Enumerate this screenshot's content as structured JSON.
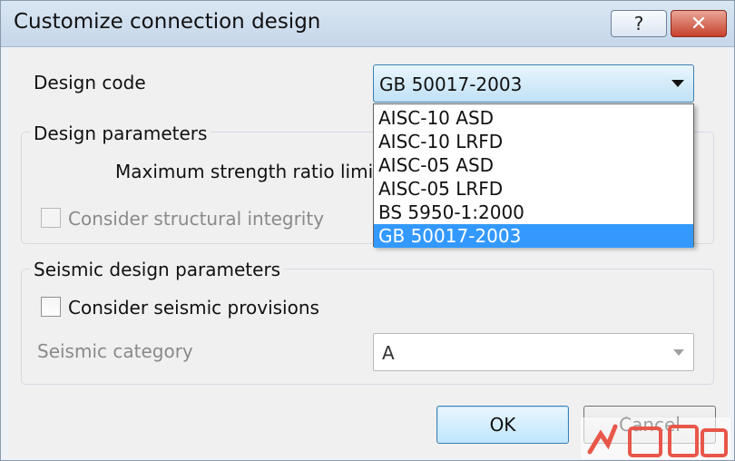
{
  "window": {
    "title": "Customize connection design",
    "help_label": "?",
    "close_label": "✕"
  },
  "design_code": {
    "label": "Design code",
    "selected": "GB 50017-2003",
    "options": [
      "AISC-10 ASD",
      "AISC-10 LRFD",
      "AISC-05 ASD",
      "AISC-05 LRFD",
      "BS 5950-1:2000",
      "GB 50017-2003"
    ],
    "selected_index": 5
  },
  "design_parameters": {
    "title": "Design parameters",
    "max_strength_label": "Maximum strength ratio limit:",
    "structural_integrity_label": "Consider structural integrity",
    "structural_integrity_checked": false
  },
  "seismic": {
    "title": "Seismic design parameters",
    "provisions_label": "Consider seismic provisions",
    "provisions_checked": false,
    "category_label": "Seismic category",
    "category_value": "A"
  },
  "buttons": {
    "ok": "OK",
    "cancel": "Cancel"
  },
  "icons": {
    "dropdown_arrow": "chevron-down-icon",
    "close": "close-icon",
    "help": "help-icon"
  }
}
